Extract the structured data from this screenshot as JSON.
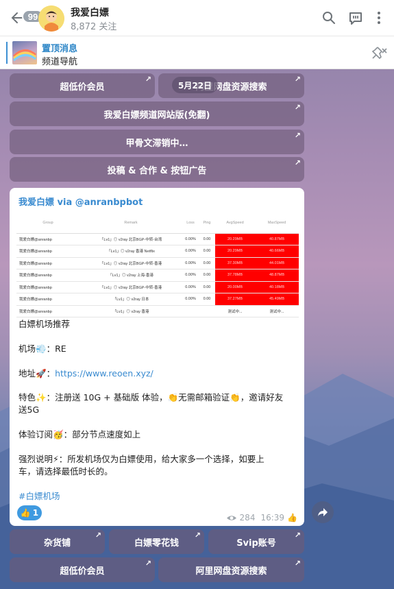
{
  "header": {
    "back_badge": "99",
    "channel_title": "我爱白嫖",
    "subscribers": "8,872 关注"
  },
  "pinned": {
    "title": "置顶消息",
    "text": "频道导航"
  },
  "top_buttons": {
    "row1": [
      "超低价会员",
      "阿里网盘资源搜索"
    ],
    "date_overlay": "5月22日",
    "row2": "我爱白嫖频道网站版(免翻)",
    "row3": "甲骨文滞销中…",
    "row4": "投稿 & 合作 & 按钮广告"
  },
  "message": {
    "author": "我爱白嫖 via @anranbpbot",
    "screenshot_table": {
      "headers": [
        "Group",
        "Remark",
        "Loss",
        "Ping",
        "AvgSpeed",
        "MaxSpeed"
      ],
      "rows": [
        [
          "我爱白嫖@anranbp",
          "「Lv1」◎ v2ray 北京BGP-中转-台湾",
          "0.00%",
          "0.00",
          "20.29MB",
          "40.87MB"
        ],
        [
          "我爱白嫖@anranbp",
          "「Lv1」◎ v2ray 香港 Netflix",
          "0.00%",
          "0.00",
          "20.29MB",
          "40.66MB"
        ],
        [
          "我爱白嫖@anranbp",
          "「Lv1」◎ v2ray 北京BGP-中转-香港",
          "0.00%",
          "0.00",
          "37.30MB",
          "44.01MB"
        ],
        [
          "我爱白嫖@anranbp",
          "「Lv1」◎ v2ray 上海-香港",
          "0.00%",
          "0.00",
          "37.78MB",
          "48.87MB"
        ],
        [
          "我爱白嫖@anranbp",
          "「Lv1」◎ v2ray 北京BGP-中转-香港",
          "0.00%",
          "0.00",
          "20.00MB",
          "40.18MB"
        ],
        [
          "我爱白嫖@anranbp",
          "「Lv1」◎ v2ray 日本",
          "0.00%",
          "0.00",
          "37.27MB",
          "45.49MB"
        ],
        [
          "我爱白嫖@anranbp",
          "「Lv1」◎ v2ray 香港",
          "",
          "",
          "测试中...",
          "测试中..."
        ]
      ]
    },
    "line1": "白嫖机场推荐",
    "line2_prefix": "机场",
    "line2_value": "：RE",
    "line3_prefix": "地址",
    "line3_link": "https://www.reoen.xyz/",
    "line4a": "特色",
    "line4b": "：注册送 10G + 基础版 体验，",
    "line4c": "无需邮箱验证",
    "line4d": "，邀请好友",
    "line4e": "送5G",
    "line5_prefix": "体验订阅",
    "line5_value": "：部分节点速度如上",
    "line6_prefix": "强烈说明",
    "line6_value": "：所发机场仅为白嫖使用，给大家多一个选择，如要上",
    "line6_cont": "车，请选择最低时长的。",
    "hashtag": "#白嫖机场",
    "reaction_count": "1",
    "views": "284",
    "time": "16:39"
  },
  "bottom_buttons": {
    "row1": [
      "杂货铺",
      "白嫖零花钱",
      "Svip账号"
    ],
    "row2": [
      "超低价会员",
      "阿里网盘资源搜索"
    ]
  },
  "colors": {
    "accent": "#3a8bd0",
    "speed_cell": "#ff0000",
    "button_bg": "#6e5a78"
  }
}
